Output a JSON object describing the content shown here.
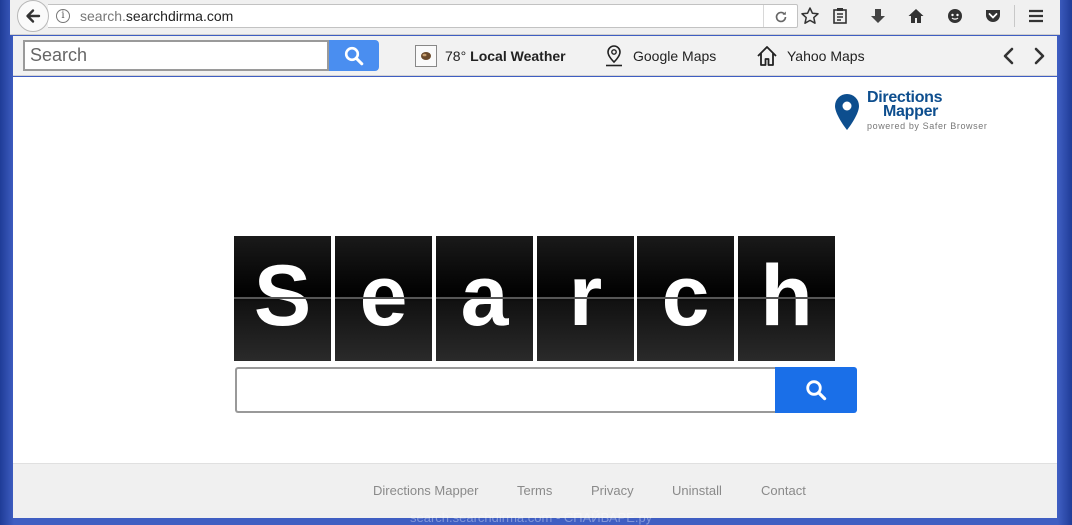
{
  "browser": {
    "url_prefix": "search.",
    "url_domain": "searchdirma.com",
    "icons": [
      "back-icon",
      "info-icon",
      "reload-icon",
      "bookmark-star-icon",
      "reading-list-icon",
      "download-icon",
      "home-icon",
      "chat-icon",
      "pocket-icon",
      "menu-icon"
    ]
  },
  "toolbar": {
    "search_placeholder": "Search",
    "weather_temp": "78°",
    "weather_label": "Local Weather",
    "google_maps": "Google Maps",
    "yahoo_maps": "Yahoo Maps"
  },
  "logo": {
    "line1": "Directions",
    "line2": "Mapper",
    "tagline": "powered by Safer Browser",
    "color": "#0d4e8e"
  },
  "hero": {
    "letters": [
      "S",
      "e",
      "a",
      "r",
      "c",
      "h"
    ]
  },
  "main_search": {
    "value": "",
    "button_color": "#1a6fe8"
  },
  "footer": {
    "links": [
      "Directions Mapper",
      "Terms",
      "Privacy",
      "Uninstall",
      "Contact"
    ]
  },
  "watermark": "search.searchdirma.com - СПАЙВАРЕ.ру"
}
